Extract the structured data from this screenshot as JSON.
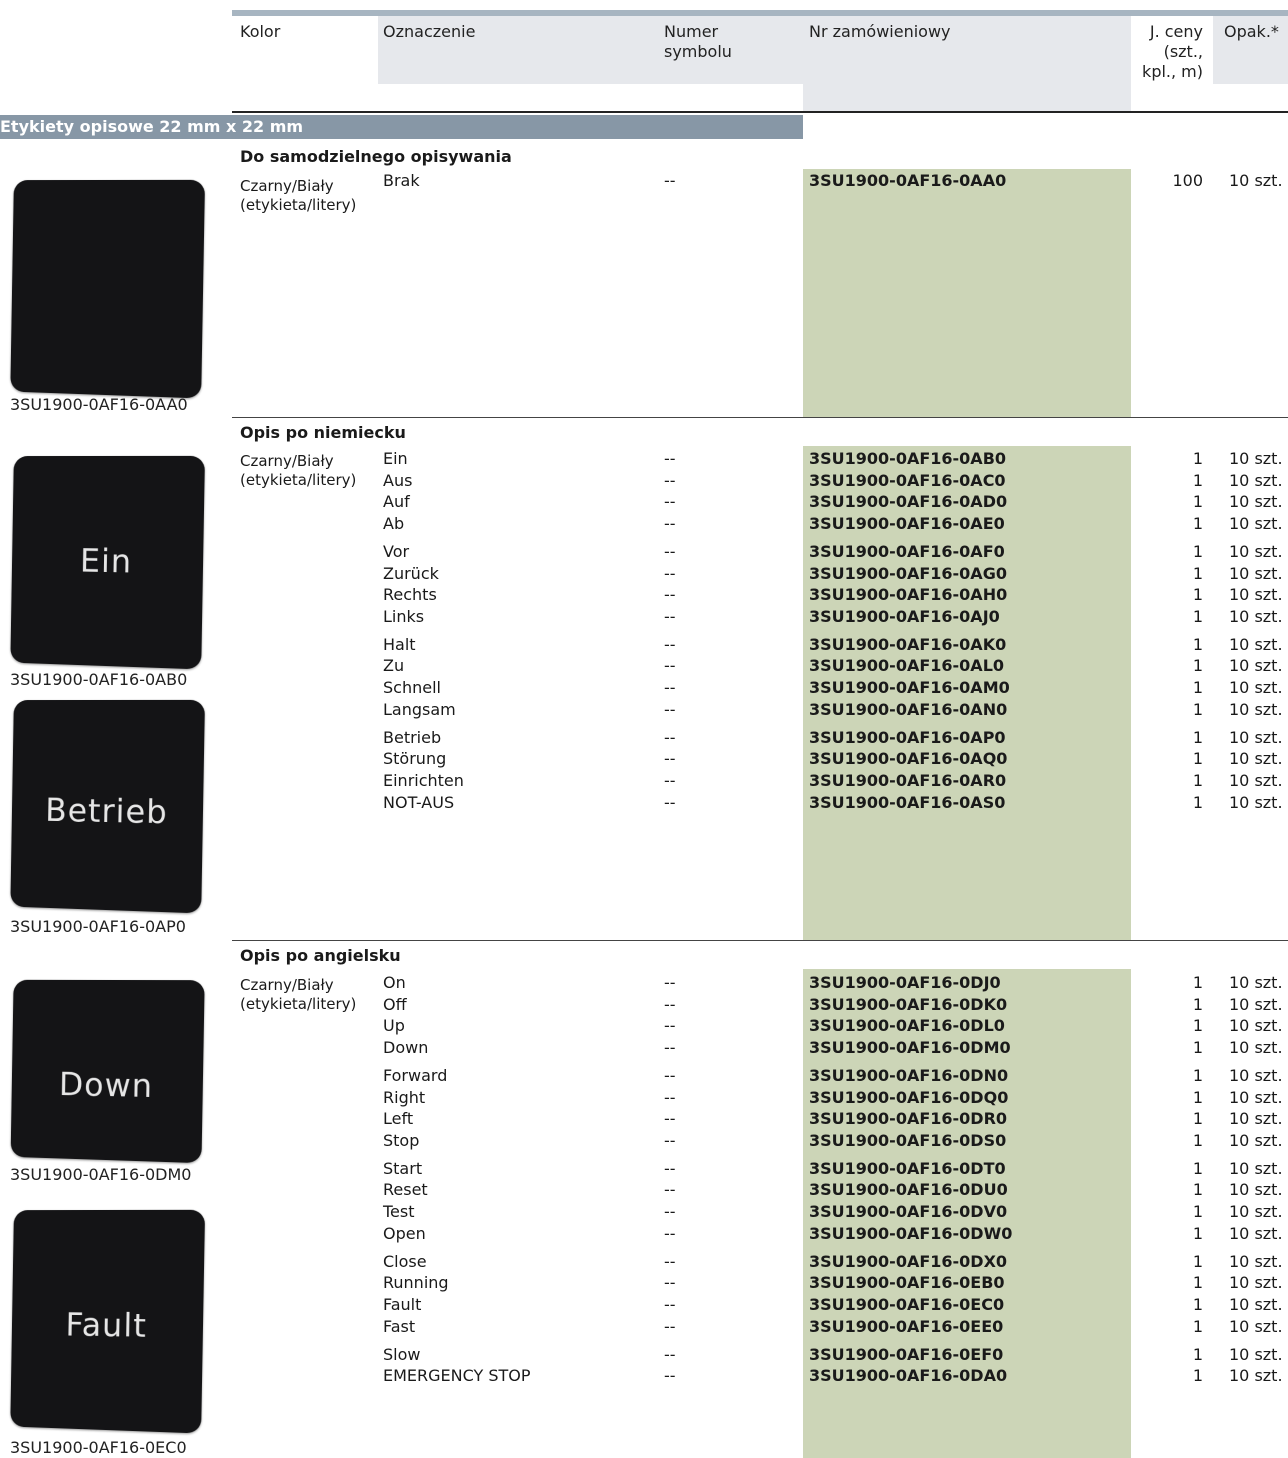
{
  "header": {
    "kolor": "Kolor",
    "oznaczenie": "Oznaczenie",
    "numer_symbolu_1": "Numer",
    "numer_symbolu_2": "symbolu",
    "nr_zamowieniowy": "Nr zamówieniowy",
    "j_ceny_1": "J. ceny",
    "j_ceny_2": "(szt.,",
    "j_ceny_3": "kpl., m)",
    "opak": "Opak.*"
  },
  "section_title": "Etykiety opisowe 22 mm x 22 mm",
  "groups": [
    {
      "title": "Do samodzielnego opisywania",
      "kolor_1": "Czarny/Biały",
      "kolor_2": "(etykieta/litery)",
      "rows": [
        {
          "name": "Brak",
          "symbol": "--",
          "order": "3SU1900-0AF16-0AA0",
          "price": "100",
          "pack": "10 szt."
        }
      ]
    },
    {
      "title": "Opis po niemiecku",
      "kolor_1": "Czarny/Biały",
      "kolor_2": "(etykieta/litery)",
      "rows": [
        {
          "name": "Ein",
          "symbol": "--",
          "order": "3SU1900-0AF16-0AB0",
          "price": "1",
          "pack": "10 szt."
        },
        {
          "name": "Aus",
          "symbol": "--",
          "order": "3SU1900-0AF16-0AC0",
          "price": "1",
          "pack": "10 szt."
        },
        {
          "name": "Auf",
          "symbol": "--",
          "order": "3SU1900-0AF16-0AD0",
          "price": "1",
          "pack": "10 szt."
        },
        {
          "name": "Ab",
          "symbol": "--",
          "order": "3SU1900-0AF16-0AE0",
          "price": "1",
          "pack": "10 szt."
        },
        {
          "name": "Vor",
          "symbol": "--",
          "order": "3SU1900-0AF16-0AF0",
          "price": "1",
          "pack": "10 szt."
        },
        {
          "name": "Zurück",
          "symbol": "--",
          "order": "3SU1900-0AF16-0AG0",
          "price": "1",
          "pack": "10 szt."
        },
        {
          "name": "Rechts",
          "symbol": "--",
          "order": "3SU1900-0AF16-0AH0",
          "price": "1",
          "pack": "10 szt."
        },
        {
          "name": "Links",
          "symbol": "--",
          "order": "3SU1900-0AF16-0AJ0",
          "price": "1",
          "pack": "10 szt."
        },
        {
          "name": "Halt",
          "symbol": "--",
          "order": "3SU1900-0AF16-0AK0",
          "price": "1",
          "pack": "10 szt."
        },
        {
          "name": "Zu",
          "symbol": "--",
          "order": "3SU1900-0AF16-0AL0",
          "price": "1",
          "pack": "10 szt."
        },
        {
          "name": "Schnell",
          "symbol": "--",
          "order": "3SU1900-0AF16-0AM0",
          "price": "1",
          "pack": "10 szt."
        },
        {
          "name": "Langsam",
          "symbol": "--",
          "order": "3SU1900-0AF16-0AN0",
          "price": "1",
          "pack": "10 szt."
        },
        {
          "name": "Betrieb",
          "symbol": "--",
          "order": "3SU1900-0AF16-0AP0",
          "price": "1",
          "pack": "10 szt."
        },
        {
          "name": "Störung",
          "symbol": "--",
          "order": "3SU1900-0AF16-0AQ0",
          "price": "1",
          "pack": "10 szt."
        },
        {
          "name": "Einrichten",
          "symbol": "--",
          "order": "3SU1900-0AF16-0AR0",
          "price": "1",
          "pack": "10 szt."
        },
        {
          "name": "NOT-AUS",
          "symbol": "--",
          "order": "3SU1900-0AF16-0AS0",
          "price": "1",
          "pack": "10 szt."
        }
      ]
    },
    {
      "title": "Opis po angielsku",
      "kolor_1": "Czarny/Biały",
      "kolor_2": "(etykieta/litery)",
      "rows": [
        {
          "name": "On",
          "symbol": "--",
          "order": "3SU1900-0AF16-0DJ0",
          "price": "1",
          "pack": "10 szt."
        },
        {
          "name": "Off",
          "symbol": "--",
          "order": "3SU1900-0AF16-0DK0",
          "price": "1",
          "pack": "10 szt."
        },
        {
          "name": "Up",
          "symbol": "--",
          "order": "3SU1900-0AF16-0DL0",
          "price": "1",
          "pack": "10 szt."
        },
        {
          "name": "Down",
          "symbol": "--",
          "order": "3SU1900-0AF16-0DM0",
          "price": "1",
          "pack": "10 szt."
        },
        {
          "name": "Forward",
          "symbol": "--",
          "order": "3SU1900-0AF16-0DN0",
          "price": "1",
          "pack": "10 szt."
        },
        {
          "name": "Right",
          "symbol": "--",
          "order": "3SU1900-0AF16-0DQ0",
          "price": "1",
          "pack": "10 szt."
        },
        {
          "name": "Left",
          "symbol": "--",
          "order": "3SU1900-0AF16-0DR0",
          "price": "1",
          "pack": "10 szt."
        },
        {
          "name": "Stop",
          "symbol": "--",
          "order": "3SU1900-0AF16-0DS0",
          "price": "1",
          "pack": "10 szt."
        },
        {
          "name": "Start",
          "symbol": "--",
          "order": "3SU1900-0AF16-0DT0",
          "price": "1",
          "pack": "10 szt."
        },
        {
          "name": "Reset",
          "symbol": "--",
          "order": "3SU1900-0AF16-0DU0",
          "price": "1",
          "pack": "10 szt."
        },
        {
          "name": "Test",
          "symbol": "--",
          "order": "3SU1900-0AF16-0DV0",
          "price": "1",
          "pack": "10 szt."
        },
        {
          "name": "Open",
          "symbol": "--",
          "order": "3SU1900-0AF16-0DW0",
          "price": "1",
          "pack": "10 szt."
        },
        {
          "name": "Close",
          "symbol": "--",
          "order": "3SU1900-0AF16-0DX0",
          "price": "1",
          "pack": "10 szt."
        },
        {
          "name": "Running",
          "symbol": "--",
          "order": "3SU1900-0AF16-0EB0",
          "price": "1",
          "pack": "10 szt."
        },
        {
          "name": "Fault",
          "symbol": "--",
          "order": "3SU1900-0AF16-0EC0",
          "price": "1",
          "pack": "10 szt."
        },
        {
          "name": "Fast",
          "symbol": "--",
          "order": "3SU1900-0AF16-0EE0",
          "price": "1",
          "pack": "10 szt."
        },
        {
          "name": "Slow",
          "symbol": "--",
          "order": "3SU1900-0AF16-0EF0",
          "price": "1",
          "pack": "10 szt."
        },
        {
          "name": "EMERGENCY STOP",
          "symbol": "--",
          "order": "3SU1900-0AF16-0DA0",
          "price": "1",
          "pack": "10 szt."
        }
      ]
    }
  ],
  "images": [
    {
      "caption": "3SU1900-0AF16-0AA0",
      "label": ""
    },
    {
      "caption": "3SU1900-0AF16-0AB0",
      "label": "Ein"
    },
    {
      "caption": "3SU1900-0AF16-0AP0",
      "label": "Betrieb"
    },
    {
      "caption": "3SU1900-0AF16-0DM0",
      "label": "Down"
    },
    {
      "caption": "3SU1900-0AF16-0EC0",
      "label": "Fault"
    }
  ],
  "colors": {
    "accent_bar": "#8797a6",
    "order_bg": "#ccd5b7",
    "header_shade": "#e6e8ec",
    "tile": "#141416"
  }
}
